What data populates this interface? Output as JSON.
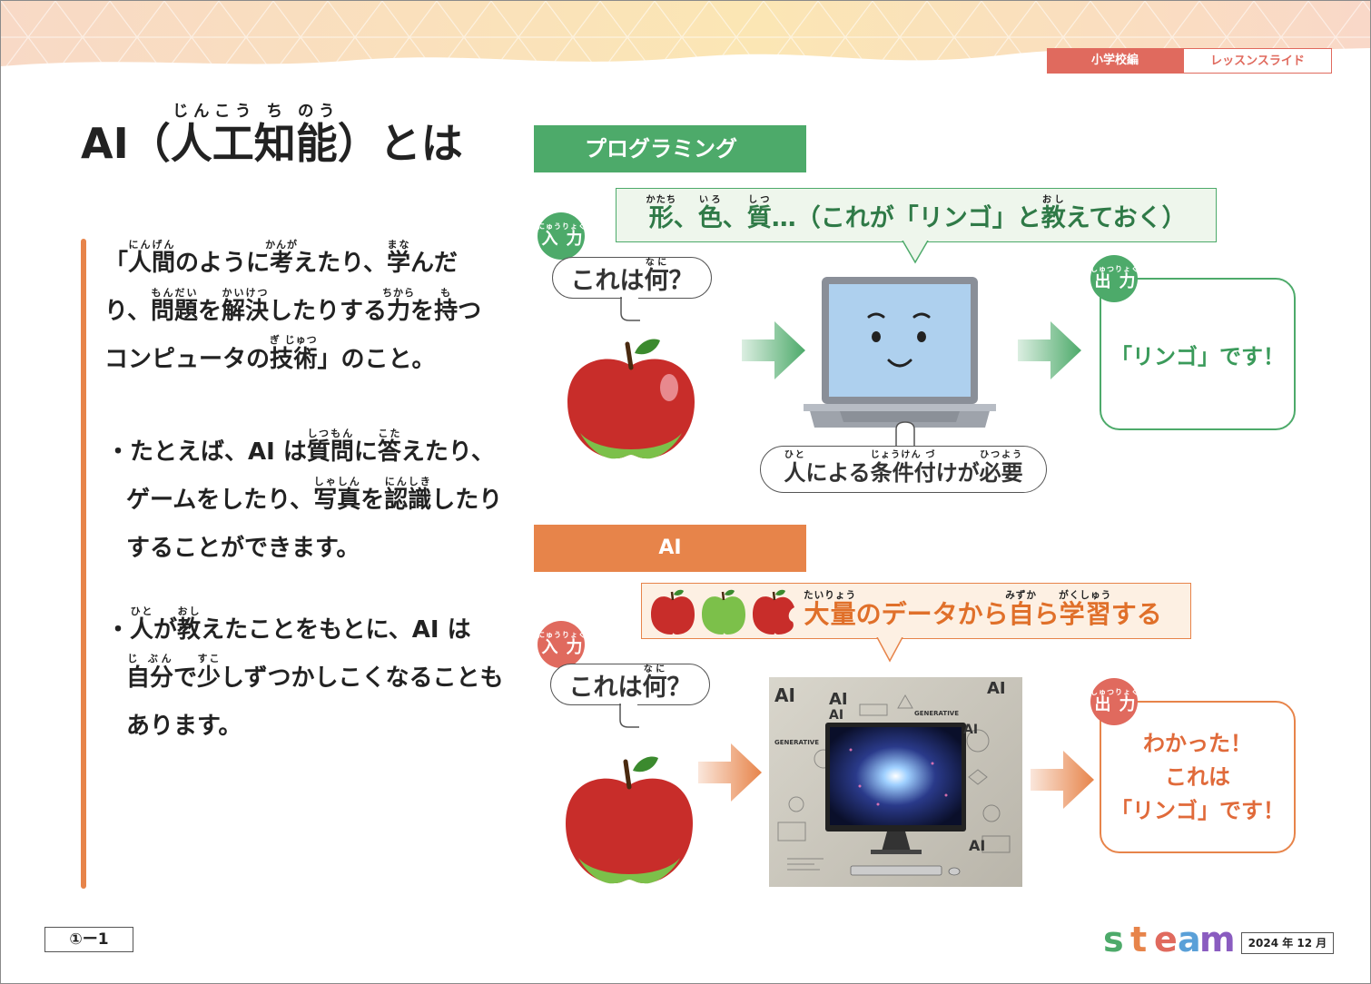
{
  "header": {
    "grade_tag": "小学校編",
    "type_tag": "レッスンスライド"
  },
  "title": {
    "prefix": "AI（",
    "word": "人工知能",
    "word_ruby": "じんこう ち のう",
    "suffix": "）とは"
  },
  "definition": {
    "q_open": "「",
    "w1": "人間",
    "w1_ruby": "にんげん",
    "t1": "のように",
    "w2": "考",
    "w2_ruby": "かんが",
    "t2": "えたり、",
    "w3": "学",
    "w3_ruby": "まな",
    "t3": "んだり、",
    "w4": "問題",
    "w4_ruby": "もんだい",
    "t4": "を",
    "w5": "解決",
    "w5_ruby": "かいけつ",
    "t5": "したりする",
    "w6": "力",
    "w6_ruby": "ちから",
    "t6": "を",
    "w7": "持",
    "w7_ruby": "も",
    "t7": "つコンピュータの",
    "w8": "技術",
    "w8_ruby": "ぎ じゅつ",
    "t8": "」のこと。"
  },
  "bullet1": {
    "dot": "・",
    "t1": "たとえば、AI は",
    "w1": "質問",
    "w1_ruby": "しつもん",
    "t2": "に",
    "w2": "答",
    "w2_ruby": "こた",
    "t3": "えたり、ゲームをしたり、",
    "w3": "写真",
    "w3_ruby": "しゃしん",
    "t4": "を",
    "w4": "認",
    "w4_ruby": "にん",
    "w5": "識",
    "w5_ruby": "しき",
    "t5": "したりすることができます。"
  },
  "bullet2": {
    "dot": "・",
    "w1": "人",
    "w1_ruby": "ひと",
    "t1": "が",
    "w2": "教",
    "w2_ruby": "おし",
    "t2": "えたことをもとに、AI は",
    "w3": "自分",
    "w3_ruby": "じ ぶん",
    "t3": "で",
    "w4": "少",
    "w4_ruby": "すこ",
    "t4": "しずつかしこくなることもあります。"
  },
  "programming": {
    "section_label": "プログラミング",
    "callout": {
      "w1": "形",
      "w1_ruby": "かたち",
      "t1": "、",
      "w2": "色",
      "w2_ruby": "いろ",
      "t2": "、",
      "w3": "質",
      "w3_ruby": "しつ",
      "t3": "…（これが「リンゴ」と",
      "w4": "教",
      "w4_ruby": "おし",
      "t4": "えておく）"
    },
    "input_badge": "入力",
    "input_badge_ruby": "にゅうりょく",
    "question": "これは",
    "question_kanji": "何",
    "question_ruby": "なに",
    "question_end": "？",
    "output_badge": "出力",
    "output_badge_ruby": "しゅつりょく",
    "output_text": "「リンゴ」です！",
    "condition": {
      "w1": "人",
      "w1_ruby": "ひと",
      "t1": "による",
      "w2": "条件付",
      "w2_ruby": "じょうけん づ",
      "t2": "けが",
      "w3": "必要",
      "w3_ruby": "ひつよう"
    }
  },
  "ai": {
    "section_label": "AI",
    "callout": {
      "w1": "大量",
      "w1_ruby": "たいりょう",
      "t1": "のデータから",
      "w2": "自",
      "w2_ruby": "みずか",
      "t2": "ら",
      "w3": "学習",
      "w3_ruby": "がくしゅう",
      "t3": "する"
    },
    "input_badge": "入力",
    "input_badge_ruby": "にゅうりょく",
    "question": "これは",
    "question_kanji": "何",
    "question_ruby": "なに",
    "question_end": "？",
    "output_badge": "出力",
    "output_badge_ruby": "しゅつりょく",
    "output_lines": [
      "わかった！",
      "これは",
      "「リンゴ」です！"
    ],
    "screen_labels": [
      "AI",
      "AI",
      "AI",
      "AI",
      "AI",
      "GENERATIVE",
      "GENERATIVE",
      "AI"
    ]
  },
  "footer": {
    "page_number": "①ー1",
    "logo_text": "steam",
    "date": "2024 年 12 月"
  },
  "colors": {
    "green": "#4daa6a",
    "orange": "#e7844a",
    "tag_red": "#e06a5e"
  }
}
